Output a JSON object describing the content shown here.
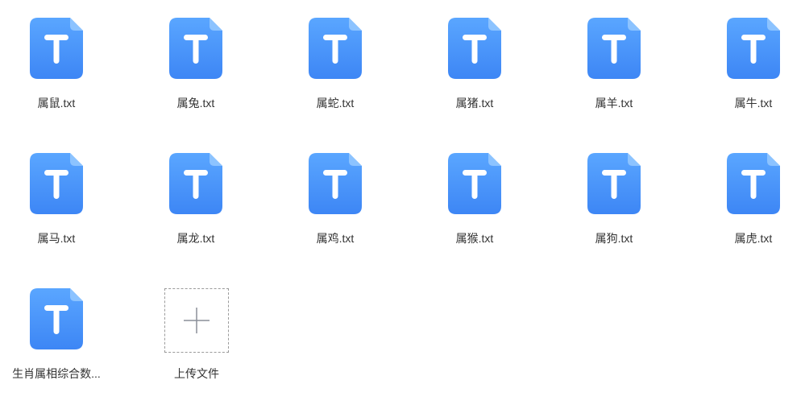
{
  "files": [
    {
      "name": "属鼠.txt",
      "icon": "txt-file-icon"
    },
    {
      "name": "属兔.txt",
      "icon": "txt-file-icon"
    },
    {
      "name": "属蛇.txt",
      "icon": "txt-file-icon"
    },
    {
      "name": "属猪.txt",
      "icon": "txt-file-icon"
    },
    {
      "name": "属羊.txt",
      "icon": "txt-file-icon"
    },
    {
      "name": "属牛.txt",
      "icon": "txt-file-icon"
    },
    {
      "name": "属马.txt",
      "icon": "txt-file-icon"
    },
    {
      "name": "属龙.txt",
      "icon": "txt-file-icon"
    },
    {
      "name": "属鸡.txt",
      "icon": "txt-file-icon"
    },
    {
      "name": "属猴.txt",
      "icon": "txt-file-icon"
    },
    {
      "name": "属狗.txt",
      "icon": "txt-file-icon"
    },
    {
      "name": "属虎.txt",
      "icon": "txt-file-icon"
    },
    {
      "name": "生肖属相综合数...",
      "icon": "txt-file-icon"
    }
  ],
  "upload": {
    "label": "上传文件",
    "icon": "plus-icon"
  },
  "colors": {
    "icon_top": "#5aa6ff",
    "icon_bottom": "#3d86f5",
    "icon_fold": "#8cc3ff",
    "text": "#333333",
    "dashed_border": "#9a9a9a"
  }
}
